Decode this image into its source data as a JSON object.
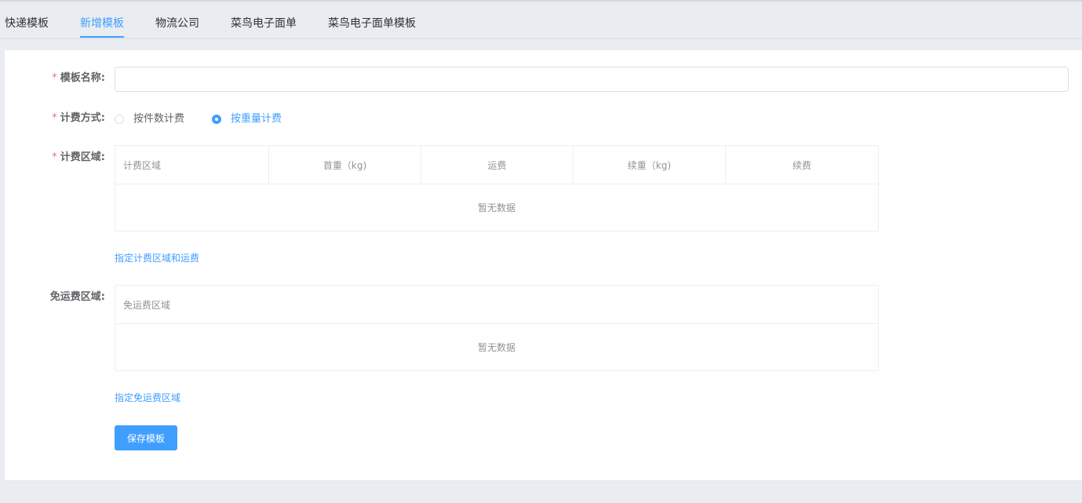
{
  "tabs": [
    "快递模板",
    "新增模板",
    "物流公司",
    "菜鸟电子面单",
    "菜鸟电子面单模板"
  ],
  "active_tab": "新增模板",
  "form": {
    "required_mark": "*",
    "template_name_label": "模板名称:",
    "template_name_value": "",
    "billing_method_label": "计费方式:",
    "billing_options": [
      "按件数计费",
      "按重量计费"
    ],
    "billing_selected": "按重量计费",
    "billing_area_label": "计费区域:",
    "billing_table": {
      "columns": [
        "计费区域",
        "首重（kg)",
        "运费",
        "续重（kg)",
        "续费"
      ],
      "empty_text": "暂无数据"
    },
    "assign_billing_link": "指定计费区域和运费",
    "free_area_label": "免运费区域:",
    "free_table": {
      "columns": [
        "免运费区域"
      ],
      "empty_text": "暂无数据"
    },
    "assign_free_link": "指定免运费区域",
    "save_button": "保存模板"
  },
  "colors": {
    "accent": "#409eff",
    "required": "#f56c6c",
    "page_bg": "#e9edf1"
  }
}
